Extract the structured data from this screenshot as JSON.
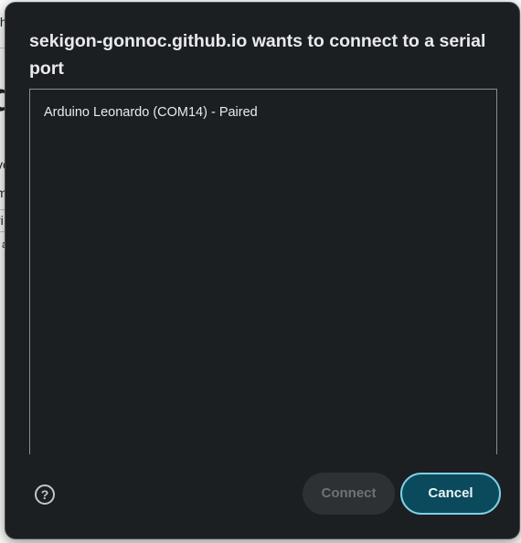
{
  "dialog": {
    "title": "sekigon-gonnoc.github.io wants to connect to a serial port",
    "ports": [
      {
        "label": "Arduino Leonardo (COM14) - Paired"
      }
    ],
    "help_glyph": "?",
    "help_icon": "help-circle-icon",
    "connect_label": "Connect",
    "cancel_label": "Cancel"
  },
  "background": {
    "fragments": [
      "th",
      "d",
      "ve",
      "m",
      "ri",
      "a"
    ]
  },
  "colors": {
    "dialog_bg": "#1c1f21",
    "accent": "#0b4a5c",
    "accent_border": "#7fd0e6",
    "text": "#e8eaed"
  }
}
